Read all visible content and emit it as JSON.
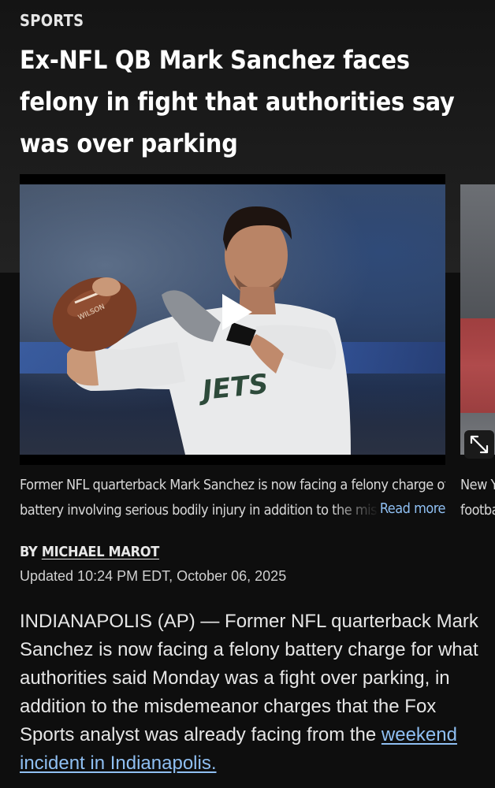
{
  "article": {
    "section": "SPORTS",
    "headline_lines": [
      "Ex-NFL QB Mark Sanchez faces",
      "felony in fight that authorities say",
      "was over parking"
    ],
    "media": {
      "jersey_text": "JETS",
      "ball_text": "WILSON",
      "caption_line1": "Former NFL quarterback Mark Sanchez is now facing a felony charge of",
      "caption_line2": "battery involving serious bodily injury in addition to the mis",
      "read_more": "Read more",
      "next_caption_line1": "New Y",
      "next_caption_line2": "footba"
    },
    "byline_prefix": "BY",
    "author": "MICHAEL MAROT",
    "updated": "Updated 10:24 PM EDT, October 06, 2025",
    "body_text": "INDIANAPOLIS (AP) — Former NFL quarterback Mark Sanchez is now facing a felony battery charge for what authorities said Monday was a fight over parking, in addition to the misdemeanor charges that the Fox Sports analyst was already facing from the",
    "body_link": "weekend incident in Indianapolis."
  },
  "icons": {
    "play": "play-icon",
    "expand": "expand-icon"
  }
}
